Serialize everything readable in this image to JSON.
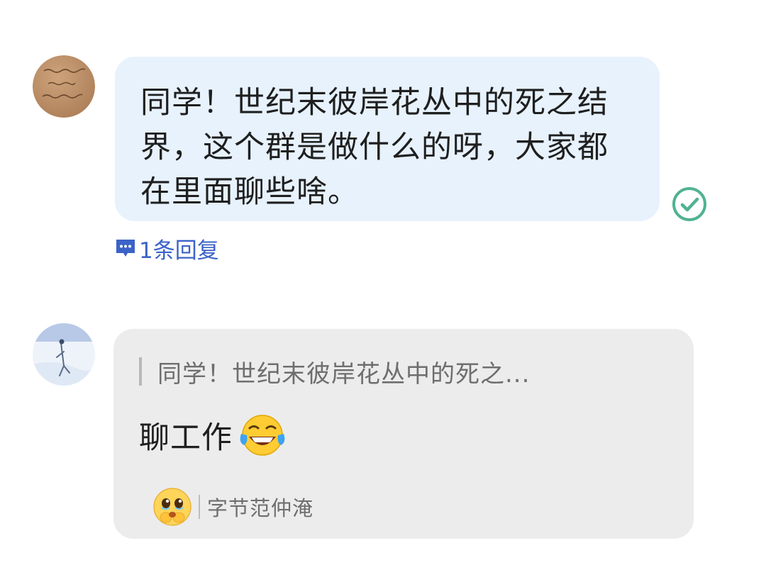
{
  "messages": [
    {
      "sender": "user",
      "text": "同学！世纪末彼岸花丛中的死之结界，这个群是做什么的呀，大家都在里面聊些啥。",
      "status_icon": "check-circle-icon",
      "reply_count_label": "1条回复"
    },
    {
      "sender": "reply",
      "quote": "同学！世纪末彼岸花丛中的死之...",
      "text": "聊工作",
      "emoji": "face-with-tears-of-joy",
      "reaction": {
        "emoji": "face-holding-back-tears",
        "user": "字节范仲淹"
      }
    }
  ],
  "colors": {
    "bubble_outgoing": "#e7f2fd",
    "bubble_reply": "#ececec",
    "check": "#4fb38f",
    "reply_link": "#3b63c7"
  }
}
